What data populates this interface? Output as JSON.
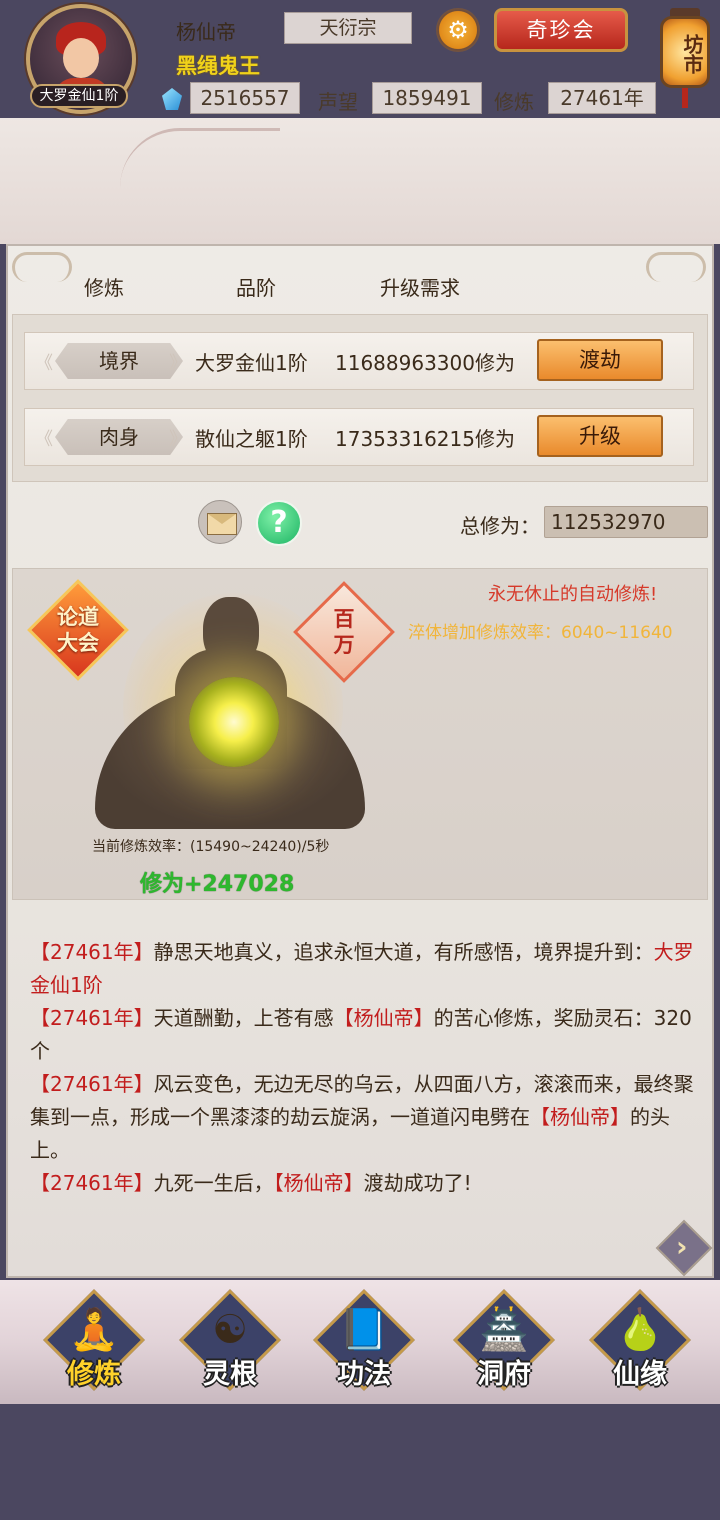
{
  "header": {
    "player_name": "杨仙帝",
    "sect": "天衍宗",
    "title": "黑绳鬼王",
    "rank": "大罗金仙1阶",
    "spirit_stones": "2516557",
    "prestige_label": "声望",
    "prestige": "1859491",
    "cultivation_label": "修炼",
    "cultivation_years": "27461年",
    "treasure_button": "奇珍会",
    "market_label": "坊市",
    "settings_icon": "gear-icon",
    "gem_icon": "blue-gem-icon"
  },
  "table": {
    "headers": [
      "修炼",
      "品阶",
      "升级需求"
    ],
    "rows": [
      {
        "name": "境界",
        "grade": "大罗金仙1阶",
        "need": "11688963300修为",
        "action": "渡劫"
      },
      {
        "name": "肉身",
        "grade": "散仙之躯1阶",
        "need": "17353316215修为",
        "action": "升级"
      }
    ]
  },
  "total": {
    "label": "总修为：",
    "value": "112532970"
  },
  "scene": {
    "badge_left": "论道\n大会",
    "badge_right": "百\n万",
    "auto_text": "永无休止的自动修炼!",
    "bonus_text": "淬体增加修炼效率：6040~11640",
    "efficiency_text": "当前修炼效率：(15490~24240)/5秒",
    "gain_text": "修为+247028"
  },
  "log": [
    {
      "year": "【27461年】",
      "text": "静思天地真义，追求永恒大道，有所感悟，境界提升到：",
      "highlight": "大罗金仙1阶"
    },
    {
      "year": "【27461年】",
      "text_a": "天道酬勤，上苍有感",
      "name": "【杨仙帝】",
      "text_b": "的苦心修炼，奖励灵石：320个"
    },
    {
      "year": "【27461年】",
      "text_a": "风云变色，无边无尽的乌云，从四面八方，滚滚而来，最终聚集到一点，形成一个黑漆漆的劫云旋涡，一道道闪电劈在",
      "name": "【杨仙帝】",
      "text_b": "的头上。"
    },
    {
      "year": "【27461年】",
      "text_a": "九死一生后，",
      "name": "【杨仙帝】",
      "text_b": "渡劫成功了!"
    }
  ],
  "nav": [
    {
      "label": "修炼",
      "icon": "cloaked-figure-icon",
      "active": true
    },
    {
      "label": "灵根",
      "icon": "sword-yinyang-icon",
      "active": false
    },
    {
      "label": "功法",
      "icon": "book-icon",
      "active": false
    },
    {
      "label": "洞府",
      "icon": "pagoda-icon",
      "active": false
    },
    {
      "label": "仙缘",
      "icon": "gourd-icon",
      "active": false
    }
  ],
  "colors": {
    "accent_red": "#c21d1d",
    "title_gold": "#f0d21a",
    "gain_green": "#2eb82e",
    "button_orange": "#e98a2c"
  }
}
